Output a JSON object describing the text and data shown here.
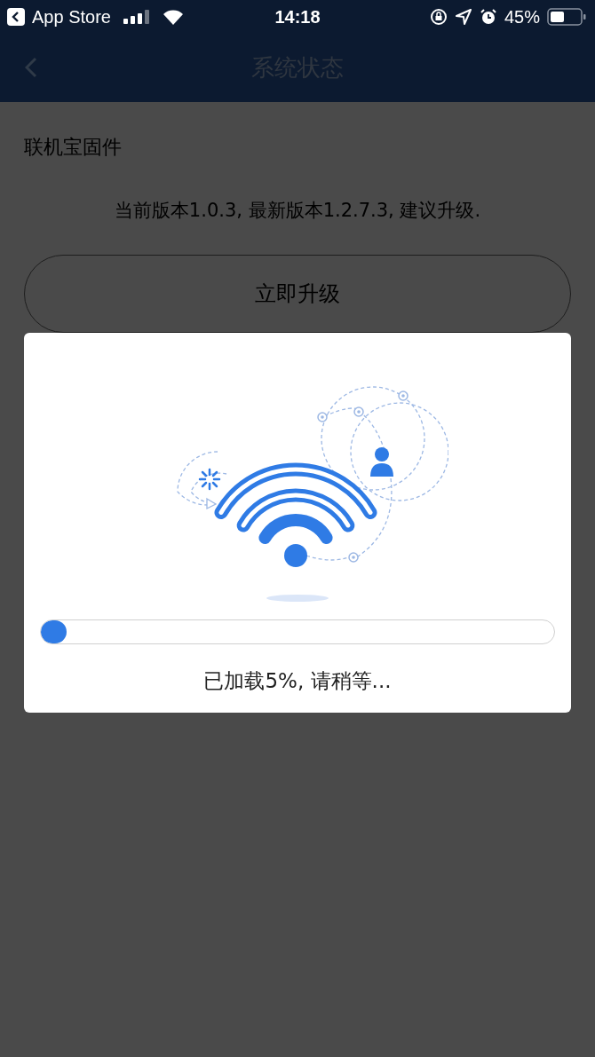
{
  "status_bar": {
    "back_app": "App Store",
    "time": "14:18",
    "battery": "45%"
  },
  "nav": {
    "title": "系统状态"
  },
  "firmware": {
    "title": "联机宝固件",
    "message": "当前版本1.0.3, 最新版本1.2.7.3, 建议升级.",
    "button": "立即升级"
  },
  "dialog": {
    "progress": {
      "level": 0.05
    },
    "status": "已加载5%, 请稍等..."
  }
}
